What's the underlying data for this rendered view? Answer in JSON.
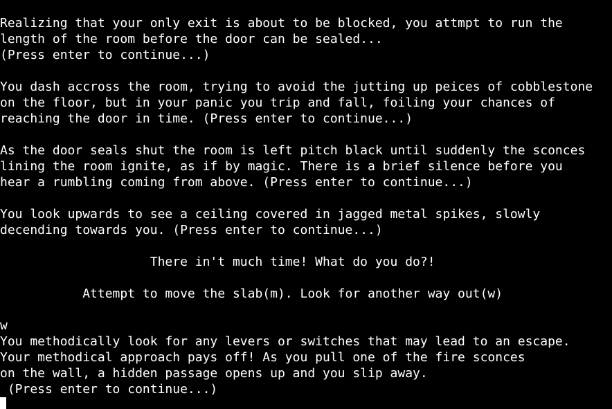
{
  "terminal": {
    "background": "#000000",
    "foreground": "#ffffff",
    "lines": [
      "Realizing that your only exit is about to be blocked, you attmpt to run the",
      "length of the room before the door can be sealed...",
      "(Press enter to continue...)",
      "",
      "You dash accross the room, trying to avoid the jutting up peices of cobblestone",
      "on the floor, but in your panic you trip and fall, foiling your chances of",
      "reaching the door in time. (Press enter to continue...)",
      "",
      "As the door seals shut the room is left pitch black until suddenly the sconces",
      "lining the room ignite, as if by magic. There is a brief silence before you",
      "hear a rumbling coming from above. (Press enter to continue...)",
      "",
      "You look upwards to see a ceiling covered in jagged metal spikes, slowly",
      "decending towards you. (Press enter to continue...)",
      "",
      "                    There in't much time! What do you do?!",
      "",
      "           Attempt to move the slab(m). Look for another way out(w)",
      "",
      "w",
      "You methodically look for any levers or switches that may lead to an escape.",
      "Your methodical approach pays off! As you pull one of the fire sconces",
      "on the wall, a hidden passage opens up and you slip away.",
      " (Press enter to continue...)"
    ]
  }
}
